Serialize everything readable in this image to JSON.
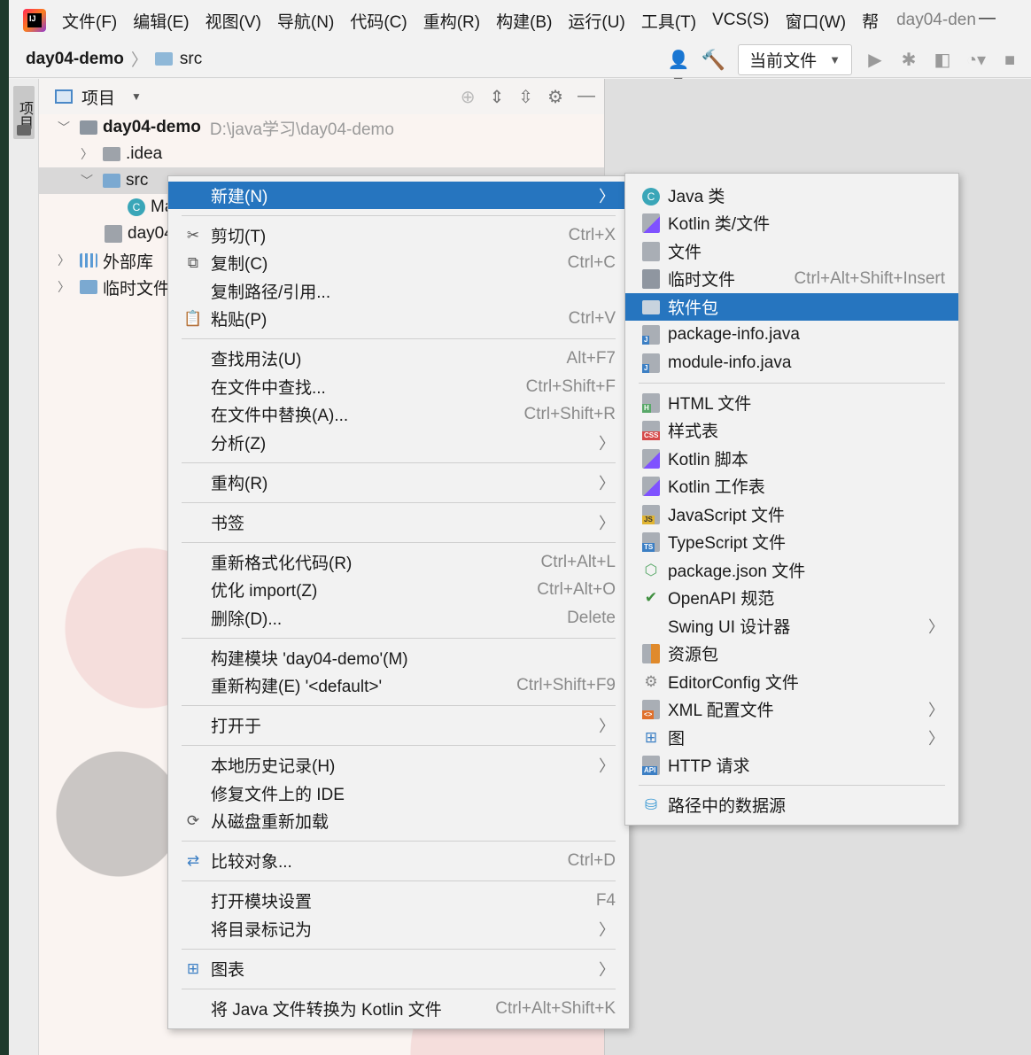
{
  "menubar": {
    "items": [
      "文件(F)",
      "编辑(E)",
      "视图(V)",
      "导航(N)",
      "代码(C)",
      "重构(R)",
      "构建(B)",
      "运行(U)",
      "工具(T)",
      "VCS(S)",
      "窗口(W)",
      "帮"
    ],
    "title": "day04-den",
    "minimize": "—"
  },
  "navbar": {
    "project": "day04-demo",
    "folder": "src",
    "run_config": "当前文件"
  },
  "stripe": {
    "tab": "项目"
  },
  "panel": {
    "title": "项目",
    "tree": {
      "root_name": "day04-demo",
      "root_path": "D:\\java学习\\day04-demo",
      "idea": ".idea",
      "src": "src",
      "main_class": "Ma",
      "iml": "day04",
      "ext_libs": "外部库",
      "scratches": "临时文件和"
    }
  },
  "context_menu": {
    "items": [
      {
        "label": "新建(N)",
        "shortcut": "",
        "submenu": true,
        "icon": ""
      },
      {
        "label": "剪切(T)",
        "shortcut": "Ctrl+X",
        "icon": "scissors-icon"
      },
      {
        "label": "复制(C)",
        "shortcut": "Ctrl+C",
        "icon": "copy-icon"
      },
      {
        "label": "复制路径/引用...",
        "shortcut": ""
      },
      {
        "label": "粘贴(P)",
        "shortcut": "Ctrl+V",
        "icon": "paste-icon"
      },
      {
        "label": "查找用法(U)",
        "shortcut": "Alt+F7"
      },
      {
        "label": "在文件中查找...",
        "shortcut": "Ctrl+Shift+F"
      },
      {
        "label": "在文件中替换(A)...",
        "shortcut": "Ctrl+Shift+R"
      },
      {
        "label": "分析(Z)",
        "submenu": true
      },
      {
        "label": "重构(R)",
        "submenu": true
      },
      {
        "label": "书签",
        "submenu": true
      },
      {
        "label": "重新格式化代码(R)",
        "shortcut": "Ctrl+Alt+L"
      },
      {
        "label": "优化 import(Z)",
        "shortcut": "Ctrl+Alt+O"
      },
      {
        "label": "删除(D)...",
        "shortcut": "Delete"
      },
      {
        "label": "构建模块 'day04-demo'(M)",
        "shortcut": ""
      },
      {
        "label": "重新构建(E) '<default>'",
        "shortcut": "Ctrl+Shift+F9"
      },
      {
        "label": "打开于",
        "submenu": true
      },
      {
        "label": "本地历史记录(H)",
        "submenu": true
      },
      {
        "label": "修复文件上的 IDE",
        "shortcut": ""
      },
      {
        "label": "从磁盘重新加载",
        "icon": "reload-icon"
      },
      {
        "label": "比较对象...",
        "shortcut": "Ctrl+D",
        "icon": "compare-icon"
      },
      {
        "label": "打开模块设置",
        "shortcut": "F4"
      },
      {
        "label": "将目录标记为",
        "submenu": true
      },
      {
        "label": "图表",
        "submenu": true,
        "icon": "diagram-icon"
      },
      {
        "label": "将 Java 文件转换为 Kotlin 文件",
        "shortcut": "Ctrl+Alt+Shift+K"
      }
    ]
  },
  "new_submenu": {
    "items": [
      {
        "label": "Java 类",
        "icon": "java-class-icon"
      },
      {
        "label": "Kotlin 类/文件",
        "icon": "kotlin-file-icon"
      },
      {
        "label": "文件",
        "icon": "file-icon"
      },
      {
        "label": "临时文件",
        "shortcut": "Ctrl+Alt+Shift+Insert",
        "icon": "scratch-file-icon"
      },
      {
        "label": "软件包",
        "icon": "package-icon"
      },
      {
        "label": "package-info.java",
        "icon": "java-file-icon"
      },
      {
        "label": "module-info.java",
        "icon": "java-file-icon"
      },
      {
        "label": "HTML 文件",
        "icon": "html-file-icon"
      },
      {
        "label": "样式表",
        "icon": "css-file-icon"
      },
      {
        "label": "Kotlin 脚本",
        "icon": "kotlin-script-icon"
      },
      {
        "label": "Kotlin 工作表",
        "icon": "kotlin-worksheet-icon"
      },
      {
        "label": "JavaScript 文件",
        "icon": "js-file-icon"
      },
      {
        "label": "TypeScript 文件",
        "icon": "ts-file-icon"
      },
      {
        "label": "package.json 文件",
        "icon": "nodejs-icon"
      },
      {
        "label": "OpenAPI 规范",
        "icon": "openapi-icon"
      },
      {
        "label": "Swing UI 设计器",
        "submenu": true
      },
      {
        "label": "资源包",
        "icon": "resource-bundle-icon"
      },
      {
        "label": "EditorConfig 文件",
        "icon": "gear-icon"
      },
      {
        "label": "XML 配置文件",
        "submenu": true,
        "icon": "xml-file-icon"
      },
      {
        "label": "图",
        "submenu": true,
        "icon": "diagram-icon"
      },
      {
        "label": "HTTP 请求",
        "icon": "api-icon"
      },
      {
        "label": "路径中的数据源",
        "icon": "database-icon"
      }
    ]
  },
  "file_badges": {
    "h": "H",
    "css": "CSS",
    "js": "JS",
    "ts": "TS",
    "api": "API",
    "j": "J",
    "xml": "<>"
  },
  "colors": {
    "highlight": "#2675bf",
    "accent_green": "#4c8c2c"
  }
}
